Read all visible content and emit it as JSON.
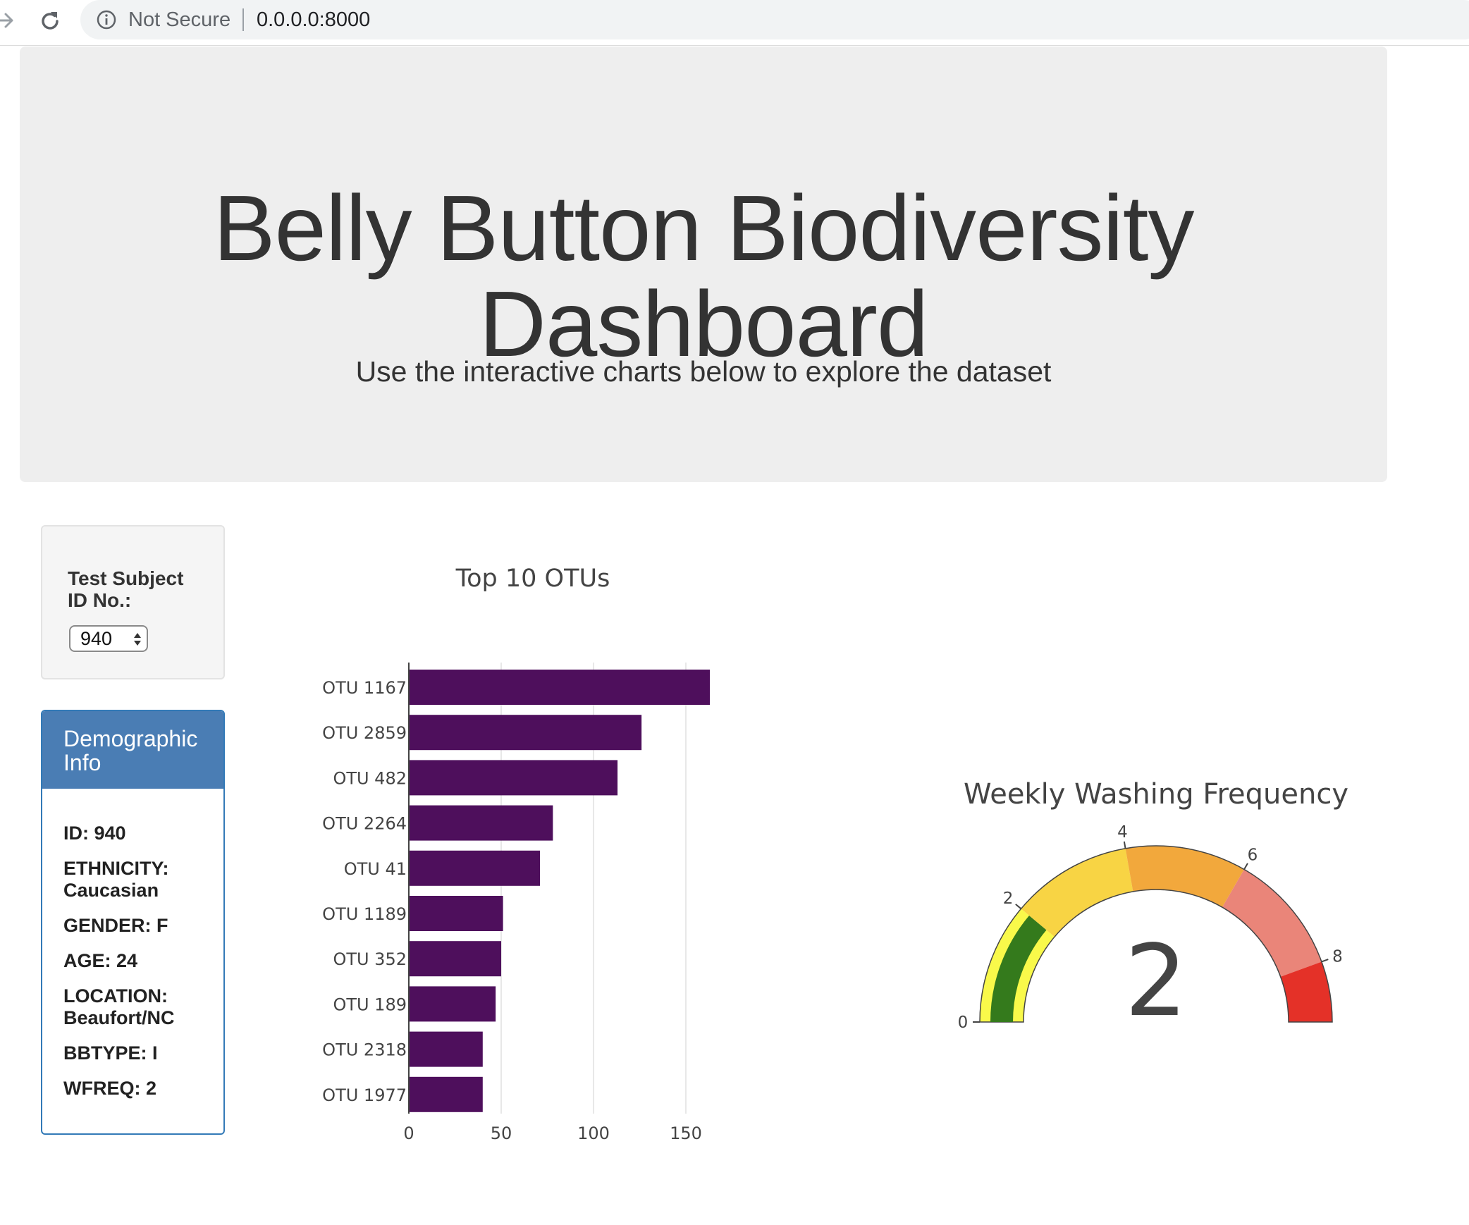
{
  "browser": {
    "security_label": "Not Secure",
    "url": "0.0.0.0:8000"
  },
  "header": {
    "title_line1": "Belly Button Biodiversity",
    "title_line2": "Dashboard",
    "subtitle": "Use the interactive charts below to explore the dataset"
  },
  "selector": {
    "label": "Test Subject ID No.:",
    "selected_value": "940"
  },
  "demographics": {
    "heading": "Demographic Info",
    "items": [
      "ID: 940",
      "ETHNICITY: Caucasian",
      "GENDER: F",
      "AGE: 24",
      "LOCATION: Beaufort/NC",
      "BBTYPE: I",
      "WFREQ: 2"
    ]
  },
  "chart_data": [
    {
      "type": "bar",
      "orientation": "horizontal",
      "title": "Top 10 OTUs",
      "categories": [
        "OTU 1167",
        "OTU 2859",
        "OTU 482",
        "OTU 2264",
        "OTU 41",
        "OTU 1189",
        "OTU 352",
        "OTU 189",
        "OTU 2318",
        "OTU 1977"
      ],
      "values": [
        163,
        126,
        113,
        78,
        71,
        51,
        50,
        47,
        40,
        40
      ],
      "xlim": [
        0,
        163
      ],
      "xticks": [
        0,
        50,
        100,
        150
      ],
      "bar_color": "#4e0f5c",
      "grid": true
    },
    {
      "type": "gauge",
      "title": "Weekly Washing Frequency",
      "value": 2,
      "range": [
        0,
        9
      ],
      "ticks": [
        0,
        2,
        4,
        6,
        8
      ],
      "steps": [
        {
          "range": [
            0,
            2
          ],
          "color": "#f9f94a"
        },
        {
          "range": [
            2,
            4
          ],
          "color": "#f8d444"
        },
        {
          "range": [
            4,
            6
          ],
          "color": "#f2a83c"
        },
        {
          "range": [
            6,
            8
          ],
          "color": "#ea8579"
        },
        {
          "range": [
            8,
            9
          ],
          "color": "#e43128"
        }
      ],
      "bar_color": "#347a1c"
    }
  ]
}
